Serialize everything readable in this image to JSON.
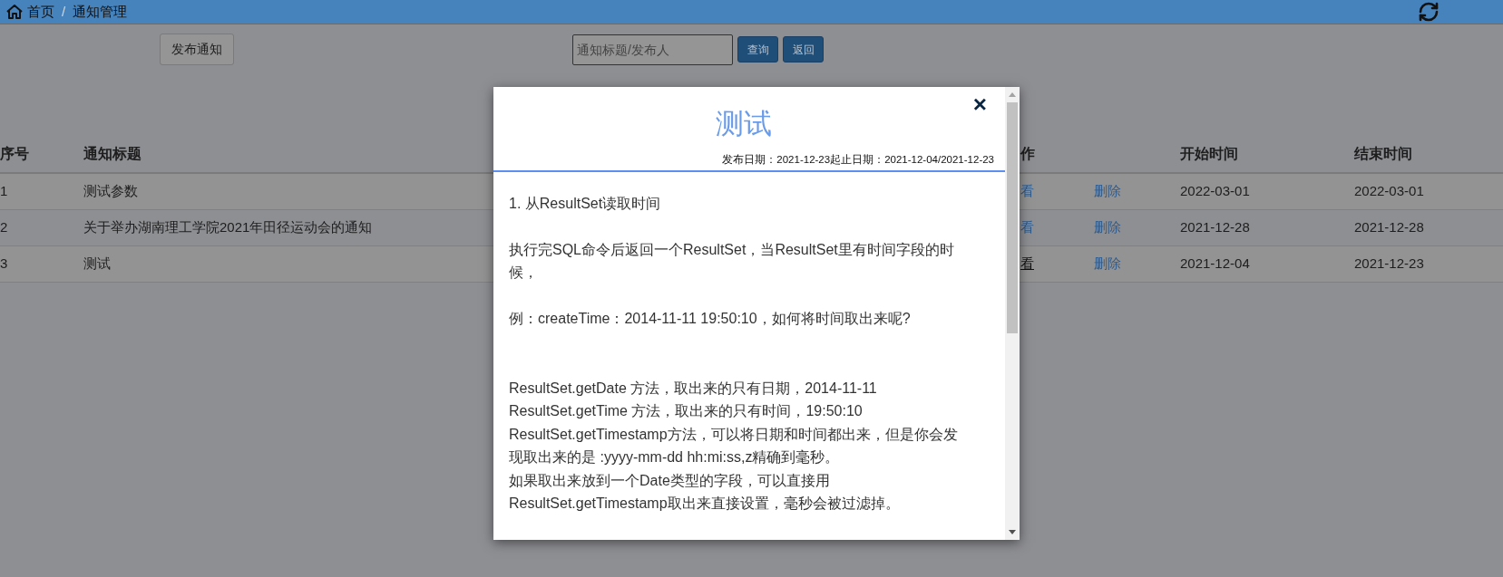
{
  "breadcrumb_separator": "/",
  "breadcrumb": [
    {
      "label": "首页",
      "kind": "home"
    },
    {
      "label": "通知管理",
      "kind": "current"
    }
  ],
  "toolbar": {
    "publish_button": "发布通知",
    "search": {
      "placeholder": "通知标题/发布人"
    },
    "query_button": "查询",
    "back_button": "返回"
  },
  "table": {
    "columns": [
      "序号",
      "通知标题",
      "作",
      "",
      "开始时间",
      "结束时间"
    ],
    "rows": [
      {
        "index": "1",
        "title": "测试参数",
        "view": "看",
        "view_hovered": false,
        "delete": "删除",
        "start": "2022-03-01",
        "end": "2022-03-01"
      },
      {
        "index": "2",
        "title": "关于举办湖南理工学院2021年田径运动会的通知",
        "view": "看",
        "view_hovered": false,
        "delete": "删除",
        "start": "2021-12-28",
        "end": "2021-12-28"
      },
      {
        "index": "3",
        "title": "测试",
        "view": "看",
        "view_hovered": true,
        "delete": "删除",
        "start": "2021-12-04",
        "end": "2021-12-23"
      }
    ]
  },
  "modal": {
    "close": "×",
    "title": "测试",
    "meta": "发布日期：2021-12-23起止日期：2021-12-04/2021-12-23",
    "body": [
      {
        "kind": "text",
        "text": "1. 从ResultSet读取时间"
      },
      {
        "kind": "blank"
      },
      {
        "kind": "text",
        "text": "执行完SQL命令后返回一个ResultSet，当ResultSet里有时间字段的时候，"
      },
      {
        "kind": "blank"
      },
      {
        "kind": "text",
        "text": "例：createTime：2014-11-11 19:50:10，如何将时间取出来呢?"
      },
      {
        "kind": "blank"
      },
      {
        "kind": "blank"
      },
      {
        "kind": "text",
        "text": "ResultSet.getDate 方法，取出来的只有日期，2014-11-11"
      },
      {
        "kind": "text",
        "text": "ResultSet.getTime 方法，取出来的只有时间，19:50:10"
      },
      {
        "kind": "text",
        "text": "ResultSet.getTimestamp方法，可以将日期和时间都出来，但是你会发现取出来的是 :yyyy-mm-dd hh:mi:ss,z精确到毫秒。"
      },
      {
        "kind": "text",
        "text": "如果取出来放到一个Date类型的字段，可以直接用ResultSet.getTimestamp取出来直接设置，毫秒会被过滤掉。"
      }
    ]
  }
}
